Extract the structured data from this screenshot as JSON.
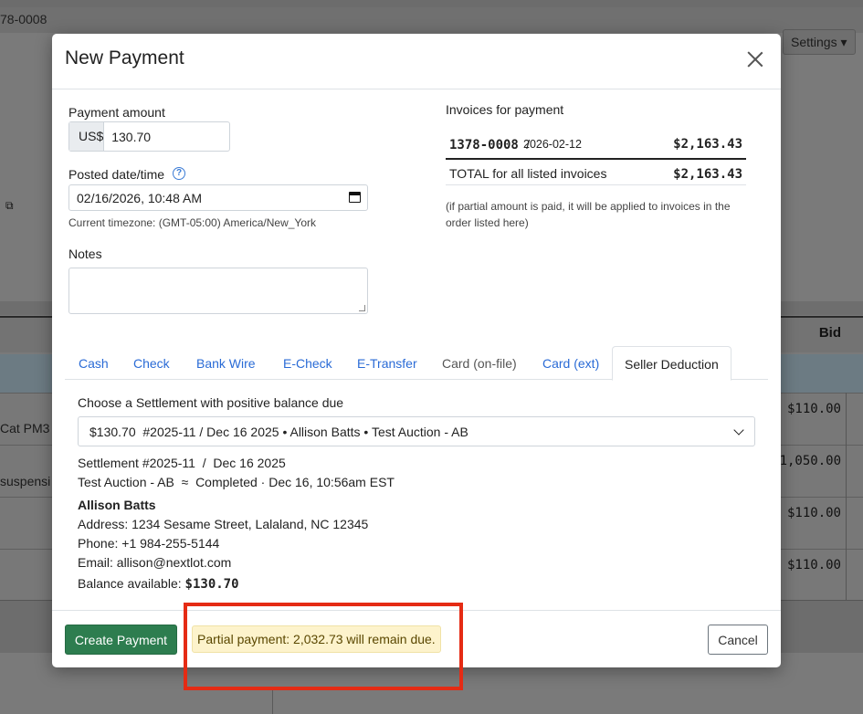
{
  "background": {
    "invoice_id_fragment": "78-0008",
    "settings_label": "Settings ▾",
    "table_header_bid": "Bid",
    "rows": [
      {
        "left": "Cat PM3",
        "right": "$110.00"
      },
      {
        "left": "suspensi",
        "right": "1,050.00"
      },
      {
        "left": "",
        "right": "$110.00"
      },
      {
        "left": "",
        "right": "$110.00"
      }
    ]
  },
  "modal": {
    "title": "New Payment",
    "payment_amount_label": "Payment amount",
    "currency_prefix": "US$",
    "payment_amount_value": "130.70",
    "posted_label": "Posted date/time",
    "help_glyph": "?",
    "posted_value": "02/16/2026, 10:48 AM",
    "timezone_note": "Current timezone: (GMT-05:00) America/New_York",
    "notes_label": "Notes",
    "notes_value": "",
    "invoices": {
      "title": "Invoices for payment",
      "items": [
        {
          "number": "1378-0008",
          "sep": "/",
          "date": "2026-02-12",
          "amount": "$2,163.43"
        }
      ],
      "total_label": "TOTAL for all listed invoices",
      "total_amount": "$2,163.43",
      "note": "(if partial amount is paid, it will be applied to invoices in the order listed here)"
    },
    "tabs": [
      {
        "label": "Cash",
        "state": "link"
      },
      {
        "label": "Check",
        "state": "link"
      },
      {
        "label": "Bank Wire",
        "state": "link"
      },
      {
        "label": "E-Check",
        "state": "link"
      },
      {
        "label": "E-Transfer",
        "state": "link"
      },
      {
        "label": "Card (on-file)",
        "state": "disabled"
      },
      {
        "label": "Card (ext)",
        "state": "link"
      },
      {
        "label": "Seller Deduction",
        "state": "active"
      }
    ],
    "settlement": {
      "choose_label": "Choose a Settlement with positive balance due",
      "selected_option": "$130.70  #2025-11 / Dec 16 2025 • Allison Batts • Test Auction - AB",
      "line1": "Settlement #2025-11  /  Dec 16 2025",
      "line2": "Test Auction - AB  ≈  Completed · Dec 16, 10:56am EST",
      "name": "Allison Batts",
      "address": "Address: 1234 Sesame Street, Lalaland, NC 12345",
      "phone": "Phone: +1 984-255-5144",
      "email": "Email: allison@nextlot.com",
      "balance_label": "Balance available:",
      "balance_value": "$130.70"
    },
    "footer": {
      "create_label": "Create Payment",
      "partial_text": "Partial payment: 2,032.73 will remain due.",
      "cancel_label": "Cancel"
    }
  },
  "colors": {
    "create_button": "#2d7d4f",
    "link_blue": "#2a6bd6",
    "warning_bg": "#fdf3cc",
    "highlight_box": "#e52b14"
  }
}
